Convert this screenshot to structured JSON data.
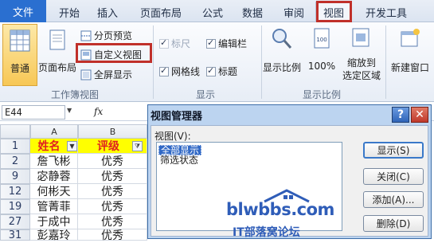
{
  "tabs": {
    "file": "文件",
    "home": "开始",
    "insert": "插入",
    "page_layout": "页面布局",
    "formulas": "公式",
    "data": "数据",
    "review": "审阅",
    "view": "视图",
    "developer": "开发工具"
  },
  "ribbon": {
    "workbook_views": {
      "label": "工作簿视图",
      "normal": "普通",
      "page_layout": "页面布局",
      "page_break_preview": "分页预览",
      "custom_views": "自定义视图",
      "full_screen": "全屏显示"
    },
    "show": {
      "label": "显示",
      "ruler": "标尺",
      "gridlines": "网格线",
      "formula_bar": "编辑栏",
      "headings": "标题"
    },
    "zoom": {
      "label": "显示比例",
      "zoom": "显示比例",
      "hundred": "100%",
      "zoom_to_selection": "缩放到",
      "zoom_to_selection_2": "选定区域"
    },
    "window": {
      "new_window": "新建窗口"
    }
  },
  "formula_bar": {
    "name_box": "E44",
    "fx": "fx"
  },
  "grid": {
    "columns": [
      "A",
      "B"
    ],
    "rows": [
      {
        "num": "1",
        "a": "姓名",
        "b": "评级"
      },
      {
        "num": "2",
        "a": "詹飞彬",
        "b": "优秀"
      },
      {
        "num": "9",
        "a": "宓静蓉",
        "b": "优秀"
      },
      {
        "num": "12",
        "a": "何彬天",
        "b": "优秀"
      },
      {
        "num": "19",
        "a": "管菁菲",
        "b": "优秀"
      },
      {
        "num": "27",
        "a": "于成中",
        "b": "优秀"
      },
      {
        "num": "31",
        "a": "彭嘉玲",
        "b": "优秀"
      }
    ]
  },
  "dialog": {
    "title": "视图管理器",
    "help": "?",
    "close": "✕",
    "views_label": "视图(V):",
    "views": [
      "全部显示",
      "筛选状态"
    ],
    "buttons": {
      "show": "显示(S)",
      "close": "关闭(C)",
      "add": "添加(A)...",
      "delete": "删除(D)"
    },
    "watermark_main": "blwbbs.com",
    "watermark_sub": "IT部落窝论坛"
  },
  "colors": {
    "highlight": "#c0302a",
    "file_tab": "#2a6fd0",
    "header_fill": "#ffff00",
    "header_text": "#e02020"
  }
}
